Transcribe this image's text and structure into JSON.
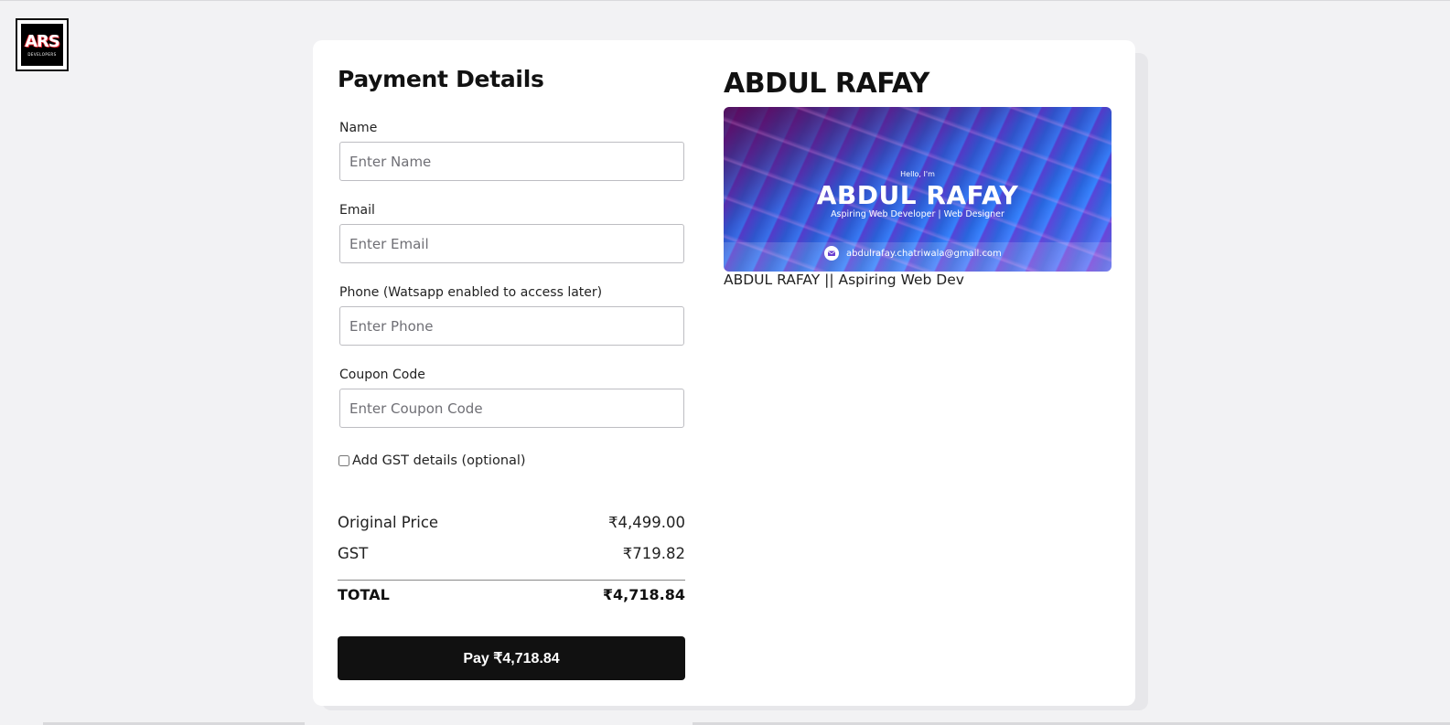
{
  "logo": {
    "text": "ARS",
    "subtext": "DEVELOPERS"
  },
  "form": {
    "title": "Payment Details",
    "fields": [
      {
        "label": "Name",
        "placeholder": "Enter Name",
        "value": ""
      },
      {
        "label": "Email",
        "placeholder": "Enter Email",
        "value": ""
      },
      {
        "label": "Phone (Watsapp enabled to access later)",
        "placeholder": "Enter Phone",
        "value": ""
      },
      {
        "label": "Coupon Code",
        "placeholder": "Enter Coupon Code",
        "value": ""
      }
    ],
    "gst_checkbox_label": "Add GST details (optional)"
  },
  "pricing": {
    "original_label": "Original Price",
    "original_value": "₹4,499.00",
    "gst_label": "GST",
    "gst_value": "₹719.82",
    "total_label": "TOTAL",
    "total_value": "₹4,718.84"
  },
  "pay_button_label": "Pay ₹4,718.84",
  "product": {
    "title": "ABDUL RAFAY",
    "banner": {
      "hello": "Hello, I'm",
      "name": "ABDUL RAFAY",
      "subtitle": "Aspiring Web Developer | Web Designer",
      "email": "abdulrafay.chatriwala@gmail.com"
    },
    "caption": "ABDUL RAFAY || Aspiring Web Dev"
  },
  "colors": {
    "page_bg": "#f2f2f4",
    "card_bg": "#ffffff",
    "button_bg": "#111111",
    "accent_logo": "#e0202a"
  }
}
